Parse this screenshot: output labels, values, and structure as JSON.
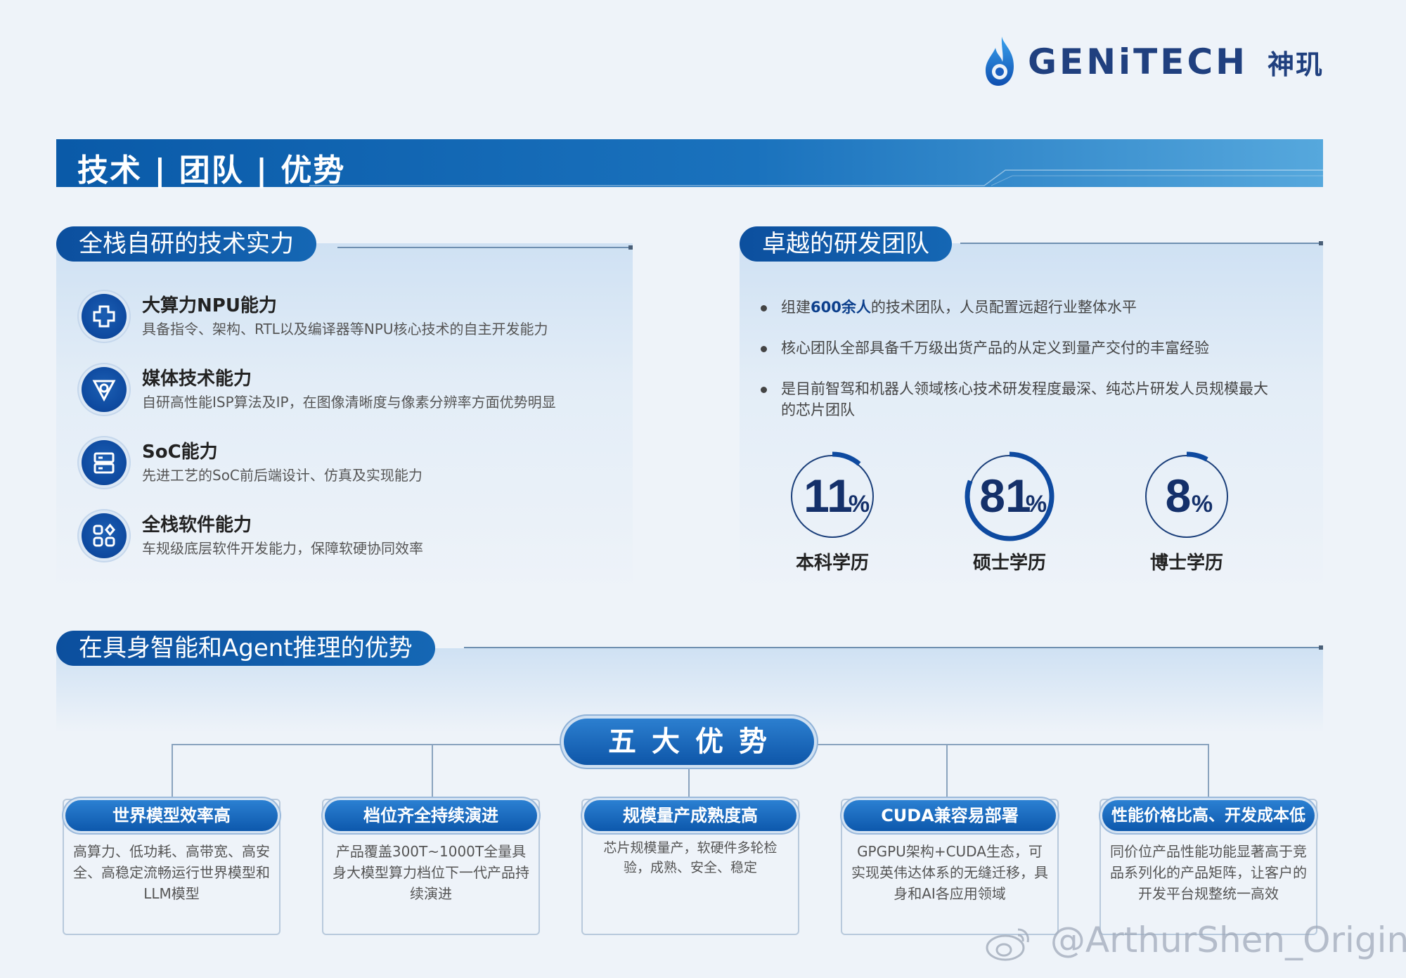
{
  "logo": {
    "brand": "GENiTECH",
    "brand_cn": "神玑"
  },
  "banner": {
    "title": "技术 | 团队 | 优势"
  },
  "tech": {
    "heading": "全栈自研的技术实力",
    "items": [
      {
        "title": "大算力NPU能力",
        "desc": "具备指令、架构、RTL以及编译器等NPU核心技术的自主开发能力",
        "icon": "npu-chip-icon"
      },
      {
        "title": "媒体技术能力",
        "desc": "自研高性能ISP算法及IP，在图像清晰度与像素分辨率方面优势明显",
        "icon": "media-triangle-icon"
      },
      {
        "title": "SoC能力",
        "desc": "先进工艺的SoC前后端设计、仿真及实现能力",
        "icon": "soc-server-icon"
      },
      {
        "title": "全栈软件能力",
        "desc": "车规级底层软件开发能力，保障软硬协同效率",
        "icon": "software-grid-icon"
      }
    ]
  },
  "team": {
    "heading": "卓越的研发团队",
    "bullets": [
      {
        "pre": "组建",
        "highlight": "600余人",
        "post": "的技术团队，人员配置远超行业整体水平"
      },
      {
        "pre": "核心团队全部具备千万级出货产品的从定义到量产交付的丰富经验",
        "highlight": "",
        "post": ""
      },
      {
        "pre": "是目前智驾和机器人领域核心技术研发程度最深、纯芯片研发人员规模最大的芯片团队",
        "highlight": "",
        "post": ""
      }
    ],
    "stats": [
      {
        "value": 11,
        "display": "11",
        "unit": "%",
        "label": "本科学历"
      },
      {
        "value": 81,
        "display": "81",
        "unit": "%",
        "label": "硕士学历"
      },
      {
        "value": 8,
        "display": "8",
        "unit": "%",
        "label": "博士学历"
      }
    ]
  },
  "advantage": {
    "heading": "在具身智能和Agent推理的优势",
    "center_title": "五大优势",
    "items": [
      {
        "title": "世界模型效率高",
        "desc": "高算力、低功耗、高带宽、高安全、高稳定流畅运行世界模型和LLM模型"
      },
      {
        "title": "档位齐全持续演进",
        "desc": "产品覆盖300T~1000T全量具身大模型算力档位下一代产品持续演进"
      },
      {
        "title": "规模量产成熟度高",
        "desc": "芯片规模量产，软硬件多轮检验，成熟、安全、稳定"
      },
      {
        "title": "CUDA兼容易部署",
        "desc": "GPGPU架构+CUDA生态，可实现英伟达体系的无缝迁移，具身和AI各应用领域"
      },
      {
        "title": "性能价格比高、开发成本低",
        "desc": "同价位产品性能功能显著高于竞品系列化的产品矩阵，让客户的开发平台规整统一高效"
      }
    ]
  },
  "watermark": {
    "text": "@ArthurShen_Origin"
  },
  "colors": {
    "primary": "#0e4aa0",
    "accent": "#1a72bd",
    "navy": "#20407f"
  }
}
